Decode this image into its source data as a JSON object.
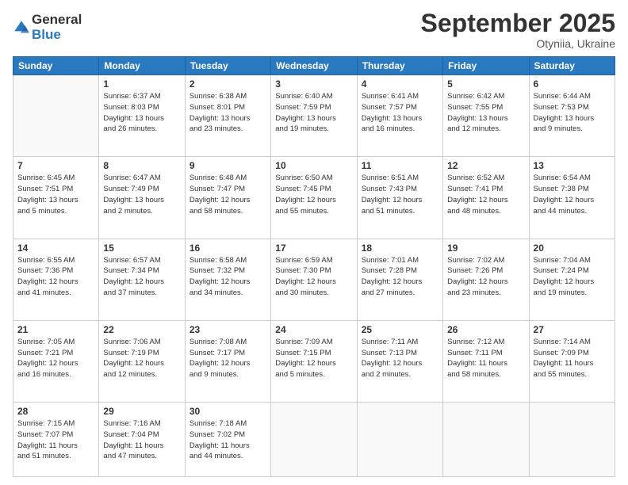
{
  "header": {
    "logo_line1": "General",
    "logo_line2": "Blue",
    "month": "September 2025",
    "location": "Otyniia, Ukraine"
  },
  "weekdays": [
    "Sunday",
    "Monday",
    "Tuesday",
    "Wednesday",
    "Thursday",
    "Friday",
    "Saturday"
  ],
  "rows": [
    [
      {
        "day": "",
        "info": ""
      },
      {
        "day": "1",
        "info": "Sunrise: 6:37 AM\nSunset: 8:03 PM\nDaylight: 13 hours\nand 26 minutes."
      },
      {
        "day": "2",
        "info": "Sunrise: 6:38 AM\nSunset: 8:01 PM\nDaylight: 13 hours\nand 23 minutes."
      },
      {
        "day": "3",
        "info": "Sunrise: 6:40 AM\nSunset: 7:59 PM\nDaylight: 13 hours\nand 19 minutes."
      },
      {
        "day": "4",
        "info": "Sunrise: 6:41 AM\nSunset: 7:57 PM\nDaylight: 13 hours\nand 16 minutes."
      },
      {
        "day": "5",
        "info": "Sunrise: 6:42 AM\nSunset: 7:55 PM\nDaylight: 13 hours\nand 12 minutes."
      },
      {
        "day": "6",
        "info": "Sunrise: 6:44 AM\nSunset: 7:53 PM\nDaylight: 13 hours\nand 9 minutes."
      }
    ],
    [
      {
        "day": "7",
        "info": "Sunrise: 6:45 AM\nSunset: 7:51 PM\nDaylight: 13 hours\nand 5 minutes."
      },
      {
        "day": "8",
        "info": "Sunrise: 6:47 AM\nSunset: 7:49 PM\nDaylight: 13 hours\nand 2 minutes."
      },
      {
        "day": "9",
        "info": "Sunrise: 6:48 AM\nSunset: 7:47 PM\nDaylight: 12 hours\nand 58 minutes."
      },
      {
        "day": "10",
        "info": "Sunrise: 6:50 AM\nSunset: 7:45 PM\nDaylight: 12 hours\nand 55 minutes."
      },
      {
        "day": "11",
        "info": "Sunrise: 6:51 AM\nSunset: 7:43 PM\nDaylight: 12 hours\nand 51 minutes."
      },
      {
        "day": "12",
        "info": "Sunrise: 6:52 AM\nSunset: 7:41 PM\nDaylight: 12 hours\nand 48 minutes."
      },
      {
        "day": "13",
        "info": "Sunrise: 6:54 AM\nSunset: 7:38 PM\nDaylight: 12 hours\nand 44 minutes."
      }
    ],
    [
      {
        "day": "14",
        "info": "Sunrise: 6:55 AM\nSunset: 7:36 PM\nDaylight: 12 hours\nand 41 minutes."
      },
      {
        "day": "15",
        "info": "Sunrise: 6:57 AM\nSunset: 7:34 PM\nDaylight: 12 hours\nand 37 minutes."
      },
      {
        "day": "16",
        "info": "Sunrise: 6:58 AM\nSunset: 7:32 PM\nDaylight: 12 hours\nand 34 minutes."
      },
      {
        "day": "17",
        "info": "Sunrise: 6:59 AM\nSunset: 7:30 PM\nDaylight: 12 hours\nand 30 minutes."
      },
      {
        "day": "18",
        "info": "Sunrise: 7:01 AM\nSunset: 7:28 PM\nDaylight: 12 hours\nand 27 minutes."
      },
      {
        "day": "19",
        "info": "Sunrise: 7:02 AM\nSunset: 7:26 PM\nDaylight: 12 hours\nand 23 minutes."
      },
      {
        "day": "20",
        "info": "Sunrise: 7:04 AM\nSunset: 7:24 PM\nDaylight: 12 hours\nand 19 minutes."
      }
    ],
    [
      {
        "day": "21",
        "info": "Sunrise: 7:05 AM\nSunset: 7:21 PM\nDaylight: 12 hours\nand 16 minutes."
      },
      {
        "day": "22",
        "info": "Sunrise: 7:06 AM\nSunset: 7:19 PM\nDaylight: 12 hours\nand 12 minutes."
      },
      {
        "day": "23",
        "info": "Sunrise: 7:08 AM\nSunset: 7:17 PM\nDaylight: 12 hours\nand 9 minutes."
      },
      {
        "day": "24",
        "info": "Sunrise: 7:09 AM\nSunset: 7:15 PM\nDaylight: 12 hours\nand 5 minutes."
      },
      {
        "day": "25",
        "info": "Sunrise: 7:11 AM\nSunset: 7:13 PM\nDaylight: 12 hours\nand 2 minutes."
      },
      {
        "day": "26",
        "info": "Sunrise: 7:12 AM\nSunset: 7:11 PM\nDaylight: 11 hours\nand 58 minutes."
      },
      {
        "day": "27",
        "info": "Sunrise: 7:14 AM\nSunset: 7:09 PM\nDaylight: 11 hours\nand 55 minutes."
      }
    ],
    [
      {
        "day": "28",
        "info": "Sunrise: 7:15 AM\nSunset: 7:07 PM\nDaylight: 11 hours\nand 51 minutes."
      },
      {
        "day": "29",
        "info": "Sunrise: 7:16 AM\nSunset: 7:04 PM\nDaylight: 11 hours\nand 47 minutes."
      },
      {
        "day": "30",
        "info": "Sunrise: 7:18 AM\nSunset: 7:02 PM\nDaylight: 11 hours\nand 44 minutes."
      },
      {
        "day": "",
        "info": ""
      },
      {
        "day": "",
        "info": ""
      },
      {
        "day": "",
        "info": ""
      },
      {
        "day": "",
        "info": ""
      }
    ]
  ]
}
